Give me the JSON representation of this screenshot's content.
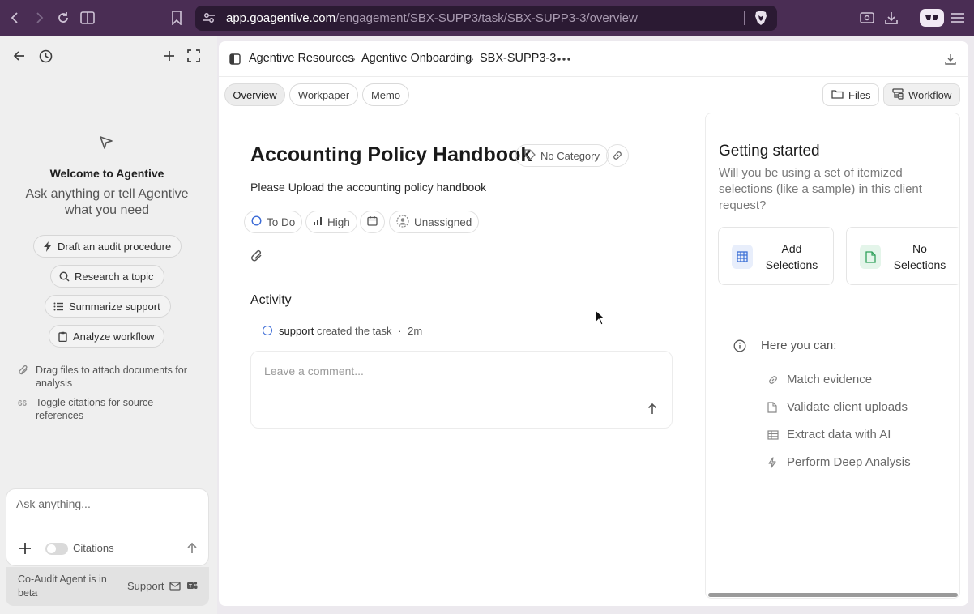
{
  "browser": {
    "url_host": "app.goagentive.com",
    "url_path": "/engagement/SBX-SUPP3/task/SBX-SUPP3-3/overview"
  },
  "sidebar": {
    "welcome_title": "Welcome to Agentive",
    "welcome_subtitle": "Ask anything or tell Agentive what you need",
    "suggestions": [
      {
        "label": "Draft an audit procedure",
        "icon": "lightning-icon"
      },
      {
        "label": "Research a topic",
        "icon": "search-icon"
      },
      {
        "label": "Summarize support",
        "icon": "list-icon"
      },
      {
        "label": "Analyze workflow",
        "icon": "clipboard-icon"
      }
    ],
    "hints": [
      {
        "text": "Drag files to attach documents for analysis",
        "icon": "paperclip-icon"
      },
      {
        "text": "Toggle citations for source references",
        "icon": "quote-icon"
      }
    ],
    "composer": {
      "placeholder": "Ask anything...",
      "citations_label": "Citations",
      "citations_on": false
    },
    "footer": {
      "beta_text": "Co-Audit Agent is in beta",
      "support_label": "Support"
    }
  },
  "breadcrumb": [
    "Agentive Resources",
    "Agentive Onboarding",
    "SBX-SUPP3-3"
  ],
  "tabs": [
    "Overview",
    "Workpaper",
    "Memo"
  ],
  "active_tab": "Overview",
  "right_buttons": {
    "files": "Files",
    "workflow": "Workflow"
  },
  "task": {
    "title": "Accounting Policy Handbook",
    "category": "No Category",
    "description": "Please Upload the accounting policy handbook",
    "status": "To Do",
    "priority": "High",
    "assignee": "Unassigned"
  },
  "activity": {
    "heading": "Activity",
    "entries": [
      {
        "user": "support",
        "action": "created the task",
        "sep": "·",
        "time": "2m"
      }
    ],
    "comment_placeholder": "Leave a comment..."
  },
  "getting_started": {
    "title": "Getting started",
    "question": "Will you be using a set of itemized selections (like a sample) in this client request?",
    "options": [
      {
        "label": "Add Selections",
        "icon": "table-icon",
        "color": "#3b6fd6",
        "bg": "#e8eefb"
      },
      {
        "label": "No Selections",
        "icon": "file-icon",
        "color": "#2ea05a",
        "bg": "#e4f5ea"
      }
    ],
    "here_label": "Here you can:",
    "features": [
      {
        "label": "Match evidence",
        "icon": "link-icon"
      },
      {
        "label": "Validate client uploads",
        "icon": "file-icon"
      },
      {
        "label": "Extract data with AI",
        "icon": "table-icon"
      },
      {
        "label": "Perform Deep Analysis",
        "icon": "bolt-icon"
      }
    ]
  }
}
